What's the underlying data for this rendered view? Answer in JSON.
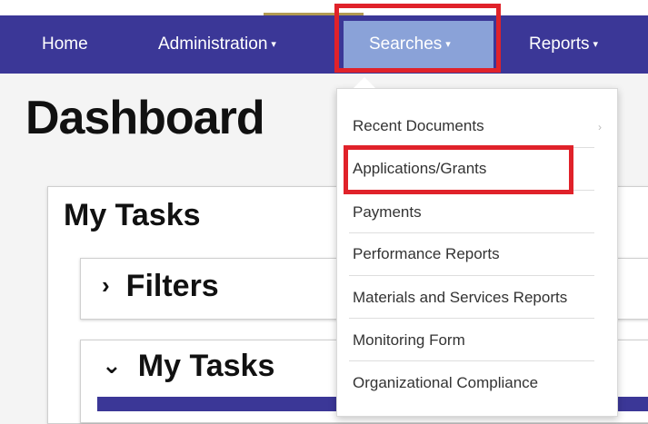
{
  "navbar": {
    "items": [
      {
        "label": "Home",
        "caret": ""
      },
      {
        "label": "Administration",
        "caret": "▾"
      },
      {
        "label": "Searches",
        "caret": "▾"
      },
      {
        "label": "Reports",
        "caret": "▾"
      }
    ]
  },
  "page": {
    "title": "Dashboard",
    "panel_title": "My Tasks",
    "filters_label": "Filters",
    "my_tasks_label": "My Tasks",
    "filters_chevron": "›",
    "my_tasks_chevron": "⌄"
  },
  "dropdown": {
    "submenu_arrow": "›",
    "items": [
      {
        "label": "Recent Documents"
      },
      {
        "label": "Applications/Grants"
      },
      {
        "label": "Payments"
      },
      {
        "label": "Performance Reports"
      },
      {
        "label": "Materials and Services Reports"
      },
      {
        "label": "Monitoring Form"
      },
      {
        "label": "Organizational Compliance"
      }
    ]
  },
  "colors": {
    "navbar": "#3b3797",
    "active_tab": "#8aa2d8",
    "highlight": "#e0222a"
  }
}
